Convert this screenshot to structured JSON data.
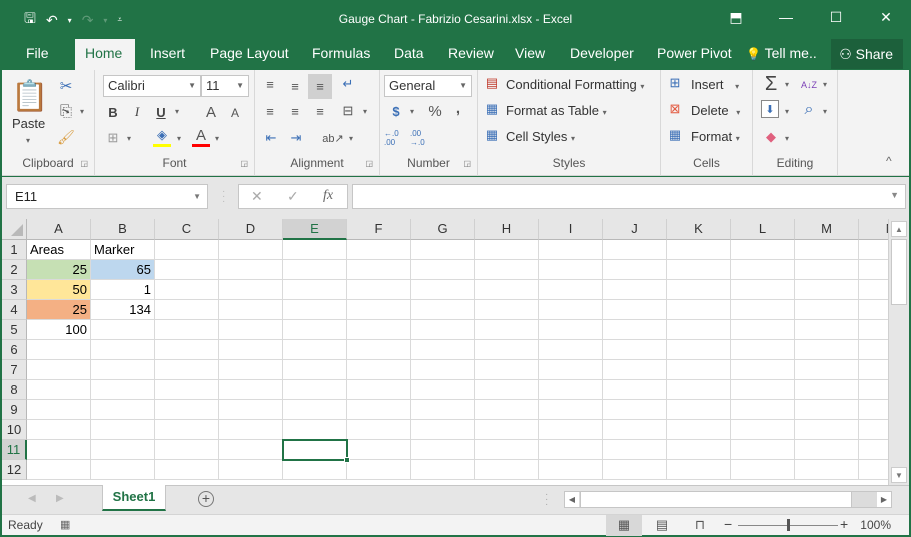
{
  "window": {
    "title": "Gauge Chart - Fabrizio Cesarini.xlsx - Excel",
    "controls": {
      "ribbon_display": "⬒",
      "minimize": "—",
      "maximize": "☐",
      "close": "✕"
    }
  },
  "qat": {
    "save_icon": "🖫",
    "undo_icon": "↶",
    "redo_icon": "↷",
    "dropdown": "▾",
    "customize": "⩡"
  },
  "ribbon_tabs": [
    "File",
    "Home",
    "Insert",
    "Page Layout",
    "Formulas",
    "Data",
    "Review",
    "View",
    "Developer",
    "Power Pivot"
  ],
  "active_tab": "Home",
  "tell_me": {
    "icon": "💡",
    "label": "Tell me.."
  },
  "share": {
    "icon": "⚇",
    "label": "Share"
  },
  "ribbon": {
    "clipboard": {
      "label": "Clipboard",
      "paste": "Paste",
      "paste_icon": "📋",
      "cut_icon": "✂",
      "copy_icon": "⎘",
      "format_painter_icon": "🖌"
    },
    "font": {
      "label": "Font",
      "font_name": "Calibri",
      "font_size": "11",
      "bold": "B",
      "italic": "I",
      "underline": "U",
      "grow": "A",
      "shrink": "A",
      "borders_icon": "⊞",
      "fill_icon": "◈",
      "font_color": "A",
      "fill_color": "#ffff00",
      "text_color": "#ff0000"
    },
    "alignment": {
      "label": "Alignment",
      "top_align": "≡",
      "middle_align": "≡",
      "bottom_align": "≡",
      "wrap_icon": "↵",
      "left": "≡",
      "center": "≡",
      "right": "≡",
      "merge_icon": "⊟",
      "decrease_indent": "⇤",
      "increase_indent": "⇥",
      "orientation": "ab↗"
    },
    "number": {
      "label": "Number",
      "format": "General",
      "accounting_icon": "$",
      "percent": "%",
      "comma": ",",
      "inc_decimal": "←.0 .00",
      "dec_decimal": ".00 →.0"
    },
    "styles": {
      "label": "Styles",
      "conditional_formatting": "Conditional Formatting",
      "format_as_table": "Format as Table",
      "cell_styles": "Cell Styles"
    },
    "cells": {
      "label": "Cells",
      "insert": "Insert",
      "delete": "Delete",
      "format": "Format"
    },
    "editing": {
      "label": "Editing",
      "autosum": "Σ",
      "sort_filter": "A↓Z",
      "fill": "⬇",
      "find": "⌕",
      "clear": "◆"
    },
    "collapse": "^"
  },
  "formula_bar": {
    "name_box": "E11",
    "cancel": "✕",
    "enter": "✓",
    "fx": "fx",
    "value": ""
  },
  "columns": [
    "A",
    "B",
    "C",
    "D",
    "E",
    "F",
    "G",
    "H",
    "I",
    "J",
    "K",
    "L",
    "M",
    "N"
  ],
  "rows": [
    "1",
    "2",
    "3",
    "4",
    "5",
    "6",
    "7",
    "8",
    "9",
    "10",
    "11",
    "12"
  ],
  "selected_cell": {
    "col": "E",
    "row": "11"
  },
  "cells": {
    "A1": "Areas",
    "B1": "Marker",
    "A2": "25",
    "B2": "65",
    "A3": "50",
    "B3": "1",
    "A4": "25",
    "B4": "134",
    "A5": "100"
  },
  "cell_fills": {
    "A2": "#c6e0b4",
    "B2": "#bdd7ee",
    "A3": "#ffe699",
    "A4": "#f4b084"
  },
  "sheets": [
    "Sheet1"
  ],
  "active_sheet": "Sheet1",
  "add_sheet": "+",
  "status": {
    "ready": "Ready",
    "macro_icon": "▦",
    "normal_view": "▦",
    "page_layout_view": "▤",
    "page_break_view": "⊓",
    "zoom_minus": "−",
    "zoom_plus": "+",
    "zoom": "100%",
    "zoom_level": 1.0
  },
  "accent": "#217346"
}
